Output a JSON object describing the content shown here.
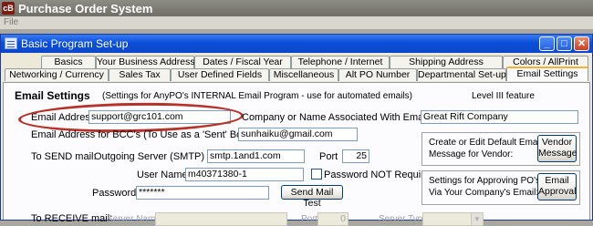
{
  "app": {
    "logo_text": "cB",
    "title": "Purchase Order System",
    "menu": [
      "File"
    ]
  },
  "dialog": {
    "title": "Basic Program Set-up",
    "controls": {
      "minimize": "_",
      "maximize": "□",
      "close": "✕"
    },
    "tabs_row1": [
      "Basics",
      "Your Business Address",
      "Dates / Fiscal Year",
      "Telephone / Internet",
      "Shipping Address",
      "Colors / AllPrint"
    ],
    "tabs_row2": [
      "Networking / Currency",
      "Sales Tax",
      "User Defined Fields",
      "Miscellaneous",
      "Alt PO Number",
      "Departmental Set-up",
      "Email Settings"
    ],
    "active_tab": "Email Settings"
  },
  "email": {
    "heading": "Email Settings",
    "subheading": "(Settings for AnyPO's INTERNAL Email Program - use for automated emails)",
    "level": "Level III feature",
    "address_label": "Email Address",
    "address_value": "support@grc101.com",
    "company_label": "Company or Name Associated With Email",
    "company_value": "Great Rift Company",
    "bcc_label": "Email Address for BCC's (To Use as a 'Sent' Box)",
    "bcc_value": "sunhaiku@gmail.com",
    "send_label": "To SEND mail:",
    "smtp_label": "Outgoing Server (SMTP)",
    "smtp_value": "smtp.1and1.com",
    "port_label": "Port",
    "port_value": "25",
    "user_label": "User Name",
    "user_value": "m40371380-1",
    "pwd_not_required_label": "Password NOT Required",
    "password_label": "Password",
    "password_value": "*******",
    "send_test_button": "Send Mail Test",
    "receive_label": "To RECEIVE mail:",
    "server_name_label": "Server Name",
    "receive_port_label": "Port",
    "receive_port_value": "0",
    "server_type_label": "Server Type"
  },
  "vendor_box": {
    "text1": "Create or Edit Default Email",
    "text2": "Message for Vendor:",
    "button_line1": "Vendor",
    "button_line2": "Message"
  },
  "approval_box": {
    "text1": "Settings for Approving PO's",
    "text2": "Via Your Company's Email:",
    "button_line1": "Email",
    "button_line2": "Approval"
  },
  "colors": {
    "accent_oval": "#b5332a",
    "titlebar_blue": "#0a4fd8",
    "tab_highlight": "#f7b232"
  }
}
